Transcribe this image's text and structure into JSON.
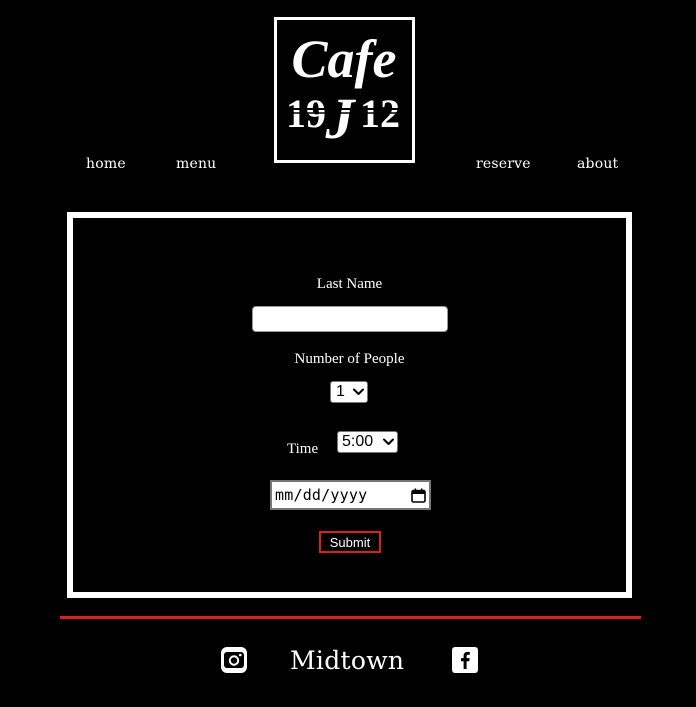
{
  "brand": {
    "logo_word": "Cafe",
    "logo_year_left": "19",
    "logo_year_right": "12",
    "logo_year_mid": "J"
  },
  "nav": {
    "home": "home",
    "menu": "menu",
    "reserve": "reserve",
    "about": "about"
  },
  "form": {
    "last_name_label": "Last Name",
    "last_name_value": "",
    "people_label": "Number of People",
    "people_value": "1",
    "time_label": "Time",
    "time_value": "5:00",
    "date_placeholder": "mm/dd/yyyy",
    "submit_label": "Submit"
  },
  "footer": {
    "location": "Midtown"
  },
  "icons": {
    "instagram": "instagram-icon",
    "facebook": "facebook-icon",
    "calendar": "calendar-icon",
    "chevron": "chevron-down-icon"
  },
  "colors": {
    "background": "#000000",
    "foreground": "#ffffff",
    "accent": "#d9201c"
  }
}
